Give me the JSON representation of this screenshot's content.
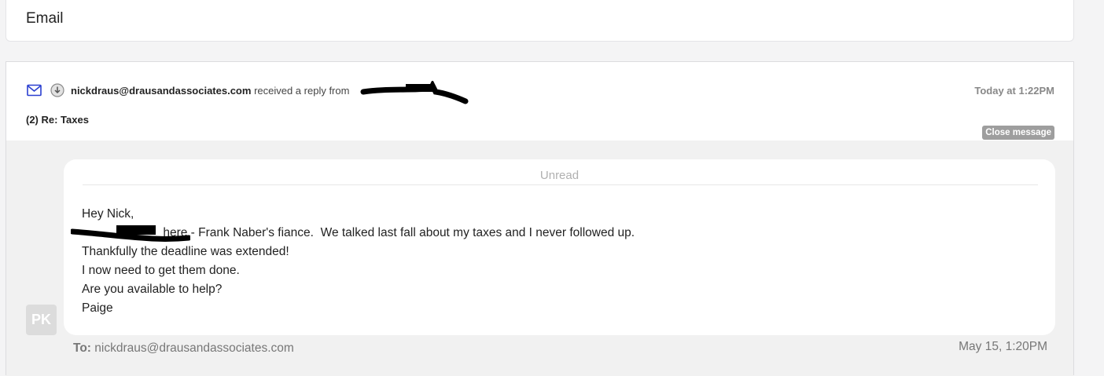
{
  "section": {
    "title": "Email"
  },
  "thread": {
    "sender_email": "nickdraus@drausandassociates.com",
    "action_text": "received a reply from",
    "replier_name": "",
    "timestamp": "Today at 1:22PM",
    "subject": "(2) Re: Taxes",
    "close_label": "Close message"
  },
  "message": {
    "status": "Unread",
    "lines": [
      "Hey Nick,",
      "                        here - Frank Naber's fiance.  We talked last fall about my taxes and I never followed up.",
      "Thankfully the deadline was extended!",
      "I now need to get them done.",
      "Are you available to help?",
      "Paige"
    ],
    "avatar_initials": "PK",
    "to_label": "To:",
    "to_address": "nickdraus@drausandassociates.com",
    "date": "May 15, 1:20PM"
  },
  "colors": {
    "mail_icon": "#2a3fd0",
    "redaction": "#000000",
    "close_button_bg": "#9e9e9e",
    "avatar_bg": "#dcdcdc"
  },
  "icons": [
    "mail-icon",
    "download-icon"
  ]
}
